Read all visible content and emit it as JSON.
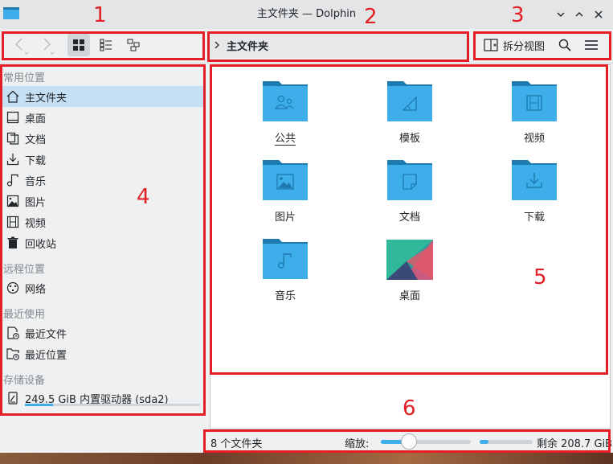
{
  "window": {
    "title": "主文件夹 — Dolphin"
  },
  "toolbar": {
    "breadcrumb": "主文件夹",
    "split_view_label": "拆分视图"
  },
  "sidebar": {
    "sections": [
      {
        "title": "常用位置",
        "items": [
          {
            "label": "主文件夹",
            "icon": "home-icon",
            "selected": true
          },
          {
            "label": "桌面",
            "icon": "desktop-icon"
          },
          {
            "label": "文档",
            "icon": "documents-icon"
          },
          {
            "label": "下载",
            "icon": "download-icon"
          },
          {
            "label": "音乐",
            "icon": "music-icon"
          },
          {
            "label": "图片",
            "icon": "pictures-icon"
          },
          {
            "label": "视频",
            "icon": "videos-icon"
          },
          {
            "label": "回收站",
            "icon": "trash-icon"
          }
        ]
      },
      {
        "title": "远程位置",
        "items": [
          {
            "label": "网络",
            "icon": "network-icon"
          }
        ]
      },
      {
        "title": "最近使用",
        "items": [
          {
            "label": "最近文件",
            "icon": "recent-files-icon"
          },
          {
            "label": "最近位置",
            "icon": "recent-locations-icon"
          }
        ]
      },
      {
        "title": "存储设备",
        "items": [
          {
            "label": "249.5 GiB 内置驱动器 (sda2)",
            "icon": "hard-drive-icon"
          }
        ]
      }
    ]
  },
  "files": [
    {
      "name": "公共",
      "icon": "folder-public-icon"
    },
    {
      "name": "模板",
      "icon": "folder-templates-icon"
    },
    {
      "name": "视频",
      "icon": "folder-videos-icon"
    },
    {
      "name": "图片",
      "icon": "folder-pictures-icon"
    },
    {
      "name": "文档",
      "icon": "folder-documents-icon"
    },
    {
      "name": "下载",
      "icon": "folder-download-icon"
    },
    {
      "name": "音乐",
      "icon": "folder-music-icon"
    },
    {
      "name": "桌面",
      "icon": "folder-desktop-icon"
    }
  ],
  "statusbar": {
    "summary": "8 个文件夹",
    "zoom_label": "缩放:",
    "zoom_level": 0.3,
    "free_space": "剩余 208.7 GiB",
    "disk_used_fraction": 0.16
  },
  "annotations": [
    "1",
    "2",
    "3",
    "4",
    "5",
    "6"
  ],
  "colors": {
    "accent": "#3daee9",
    "selection": "#c5dff4",
    "annotation": "#e31e24",
    "folder_body": "#3daee9",
    "folder_tab": "#1d7bb0"
  }
}
